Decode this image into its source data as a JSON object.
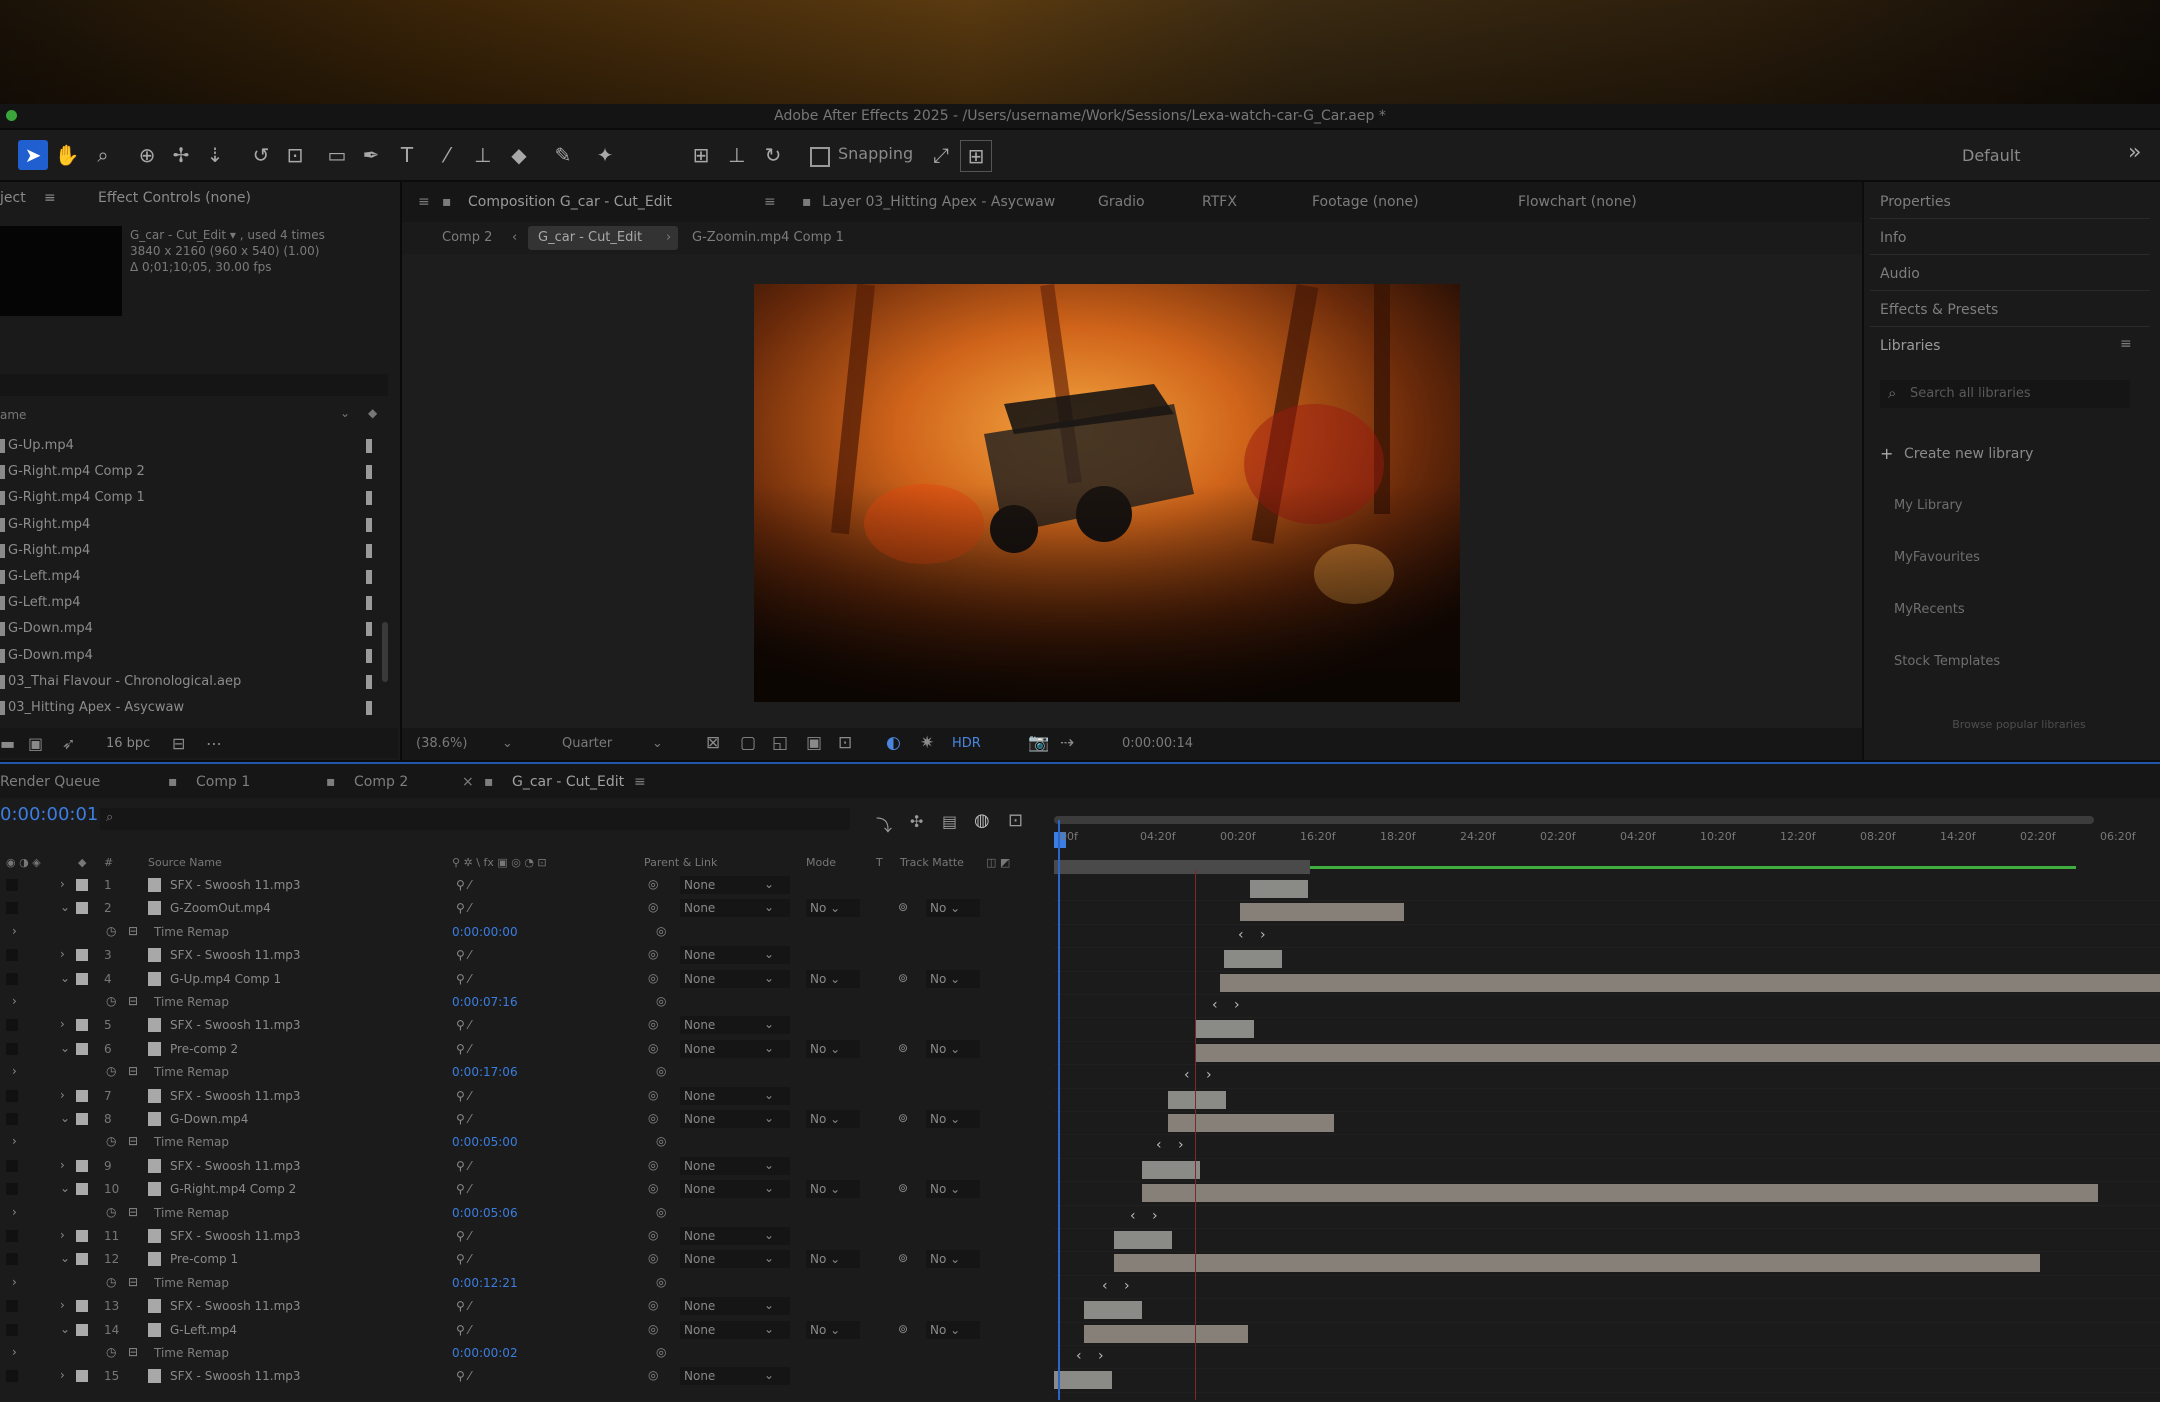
{
  "app": {
    "title": "Adobe After Effects 2025 - /Users/username/Work/Sessions/Lexa-watch-car-G_Car.aep *"
  },
  "toolbar": {
    "snapping_label": "Snapping",
    "workspace_label": "Default"
  },
  "project": {
    "tab_project": "ject",
    "tab_effect_controls": "Effect Controls (none)",
    "info_line1": "G_car - Cut_Edit ▾ , used 4 times",
    "info_line2": "3840 x 2160 (960 x 540) (1.00)",
    "info_line3": "Δ 0;01;10;05, 30.00 fps",
    "col_name": "ame",
    "items": [
      "G-Up.mp4",
      "G-Right.mp4 Comp 2",
      "G-Right.mp4 Comp 1",
      "G-Right.mp4",
      "G-Right.mp4",
      "G-Left.mp4",
      "G-Left.mp4",
      "G-Down.mp4",
      "G-Down.mp4",
      "03_Thai Flavour - Chronological.aep",
      "03_Hitting Apex - Asycwaw"
    ],
    "bpc": "16 bpc"
  },
  "composition": {
    "tab_active": "Composition G_car - Cut_Edit",
    "tab_layer": "Layer 03_Hitting Apex - Asycwaw",
    "tab_gradio": "Gradio",
    "tab_rtfx": "RTFX",
    "tab_footage": "Footage (none)",
    "tab_flowchart": "Flowchart (none)",
    "crumbs": [
      "Comp 2",
      "G_car - Cut_Edit",
      "G-Zoomin.mp4 Comp 1"
    ],
    "zoom": "(38.6%)",
    "resolution": "Quarter",
    "hdr": "HDR",
    "timecode": "0:00:00:14"
  },
  "right_panels": {
    "items": [
      "Properties",
      "Info",
      "Audio",
      "Effects & Presets",
      "Libraries"
    ],
    "search_placeholder": "Search all libraries",
    "create_new_library": "Create new library",
    "libraries": [
      "My Library",
      "MyFavourites",
      "MyRecents",
      "Stock Templates"
    ],
    "footnote": "Browse popular libraries"
  },
  "timeline": {
    "tabs": [
      "Render Queue",
      "Comp 1",
      "Comp 2",
      "G_car - Cut_Edit"
    ],
    "timecode": "0:00:00:01",
    "col_source": "Source Name",
    "col_parent": "Parent & Link",
    "col_mode": "Mode",
    "col_t": "T",
    "col_trkmat": "Track Matte",
    "ruler_ticks": [
      "00f",
      "04:20f",
      "00:20f",
      "16:20f",
      "18:20f",
      "24:20f",
      "02:20f",
      "04:20f",
      "10:20f",
      "12:20f",
      "08:20f",
      "14:20f",
      "02:20f",
      "06:20f"
    ],
    "layers": [
      {
        "num": "1",
        "name": "SFX - Swoosh 11.mp3",
        "type": "audio",
        "parent": "None"
      },
      {
        "num": "2",
        "name": "G-ZoomOut.mp4",
        "type": "video",
        "parent": "None",
        "mode": "No",
        "trk": "No"
      },
      {
        "remap": "Time Remap",
        "value": "0:00:00:00"
      },
      {
        "num": "3",
        "name": "SFX - Swoosh 11.mp3",
        "type": "audio",
        "parent": "None"
      },
      {
        "num": "4",
        "name": "G-Up.mp4 Comp 1",
        "type": "video",
        "parent": "None",
        "mode": "No",
        "trk": "No"
      },
      {
        "remap": "Time Remap",
        "value": "0:00:07:16"
      },
      {
        "num": "5",
        "name": "SFX - Swoosh 11.mp3",
        "type": "audio",
        "parent": "None"
      },
      {
        "num": "6",
        "name": "Pre-comp 2",
        "type": "video",
        "parent": "None",
        "mode": "No",
        "trk": "No"
      },
      {
        "remap": "Time Remap",
        "value": "0:00:17:06"
      },
      {
        "num": "7",
        "name": "SFX - Swoosh 11.mp3",
        "type": "audio",
        "parent": "None"
      },
      {
        "num": "8",
        "name": "G-Down.mp4",
        "type": "video",
        "parent": "None",
        "mode": "No",
        "trk": "No"
      },
      {
        "remap": "Time Remap",
        "value": "0:00:05:00"
      },
      {
        "num": "9",
        "name": "SFX - Swoosh 11.mp3",
        "type": "audio",
        "parent": "None"
      },
      {
        "num": "10",
        "name": "G-Right.mp4 Comp 2",
        "type": "video",
        "parent": "None",
        "mode": "No",
        "trk": "No"
      },
      {
        "remap": "Time Remap",
        "value": "0:00:05:06"
      },
      {
        "num": "11",
        "name": "SFX - Swoosh 11.mp3",
        "type": "audio",
        "parent": "None"
      },
      {
        "num": "12",
        "name": "Pre-comp 1",
        "type": "video",
        "parent": "None",
        "mode": "No",
        "trk": "No"
      },
      {
        "remap": "Time Remap",
        "value": "0:00:12:21"
      },
      {
        "num": "13",
        "name": "SFX - Swoosh 11.mp3",
        "type": "audio",
        "parent": "None"
      },
      {
        "num": "14",
        "name": "G-Left.mp4",
        "type": "video",
        "parent": "None",
        "mode": "No",
        "trk": "No"
      },
      {
        "remap": "Time Remap",
        "value": "0:00:00:02"
      },
      {
        "num": "15",
        "name": "SFX - Swoosh 11.mp3",
        "type": "audio",
        "parent": "None"
      }
    ]
  }
}
